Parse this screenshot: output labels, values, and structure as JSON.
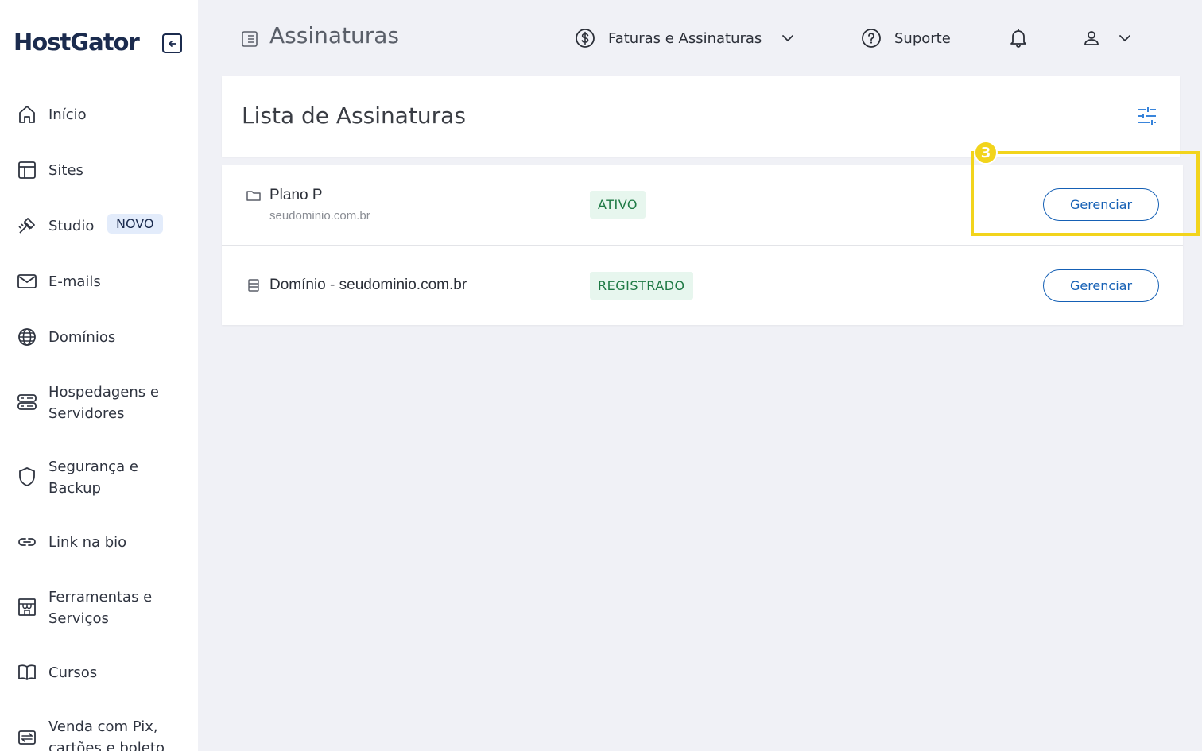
{
  "brand": {
    "name": "HostGator"
  },
  "sidebar": {
    "items": [
      {
        "label": "Início",
        "icon": "home-icon"
      },
      {
        "label": "Sites",
        "icon": "layout-icon"
      },
      {
        "label": "Studio",
        "icon": "studio-icon",
        "badge": "NOVO"
      },
      {
        "label": "E-mails",
        "icon": "mail-icon"
      },
      {
        "label": "Domínios",
        "icon": "globe-icon"
      },
      {
        "label": "Hospedagens e",
        "label2": "Servidores",
        "icon": "server-icon"
      },
      {
        "label": "Segurança e",
        "label2": "Backup",
        "icon": "shield-icon"
      },
      {
        "label": "Link na bio",
        "icon": "link-icon"
      },
      {
        "label": "Ferramentas e",
        "label2": "Serviços",
        "icon": "store-icon"
      },
      {
        "label": "Cursos",
        "icon": "book-icon"
      },
      {
        "label": "Venda com Pix,",
        "label2": "cartões e boleto",
        "icon": "exchange-icon"
      }
    ]
  },
  "header": {
    "title": "Assinaturas",
    "billing": "Faturas e Assinaturas",
    "support": "Suporte"
  },
  "card": {
    "title": "Lista de Assinaturas"
  },
  "list": [
    {
      "title": "Plano P",
      "subtitle": "seudominio.com.br",
      "status": "ATIVO",
      "action": "Gerenciar",
      "icon": "folder-icon"
    },
    {
      "title": "Domínio - seudominio.com.br",
      "status": "REGISTRADO",
      "action": "Gerenciar",
      "icon": "server-small-icon"
    }
  ],
  "annotation": {
    "step": "3",
    "color": "#f2d41c"
  },
  "colors": {
    "accent": "#1560b5",
    "status_bg": "#e7f6ee",
    "status_text": "#1f7a45",
    "brand": "#1b2b4e"
  }
}
